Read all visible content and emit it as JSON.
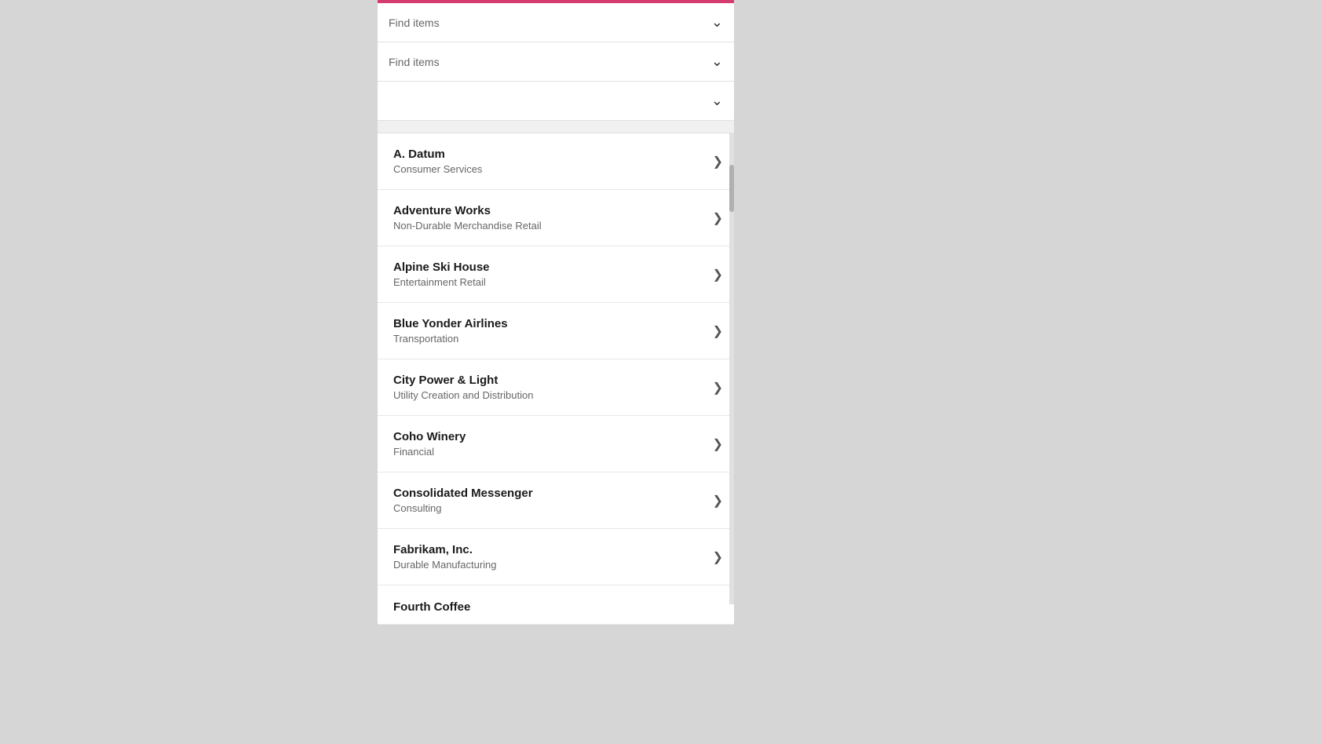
{
  "topBar": {
    "color": "#d63b6e"
  },
  "filters": [
    {
      "id": "filter1",
      "label": "Find items",
      "hasChevron": true
    },
    {
      "id": "filter2",
      "label": "Find items",
      "hasChevron": true
    },
    {
      "id": "filter3",
      "label": "",
      "hasChevron": true
    }
  ],
  "listItems": [
    {
      "id": "a-datum",
      "title": "A. Datum",
      "subtitle": "Consumer Services"
    },
    {
      "id": "adventure-works",
      "title": "Adventure Works",
      "subtitle": "Non-Durable Merchandise Retail"
    },
    {
      "id": "alpine-ski-house",
      "title": "Alpine Ski House",
      "subtitle": "Entertainment Retail"
    },
    {
      "id": "blue-yonder-airlines",
      "title": "Blue Yonder Airlines",
      "subtitle": "Transportation"
    },
    {
      "id": "city-power-light",
      "title": "City Power & Light",
      "subtitle": "Utility Creation and Distribution"
    },
    {
      "id": "coho-winery",
      "title": "Coho Winery",
      "subtitle": "Financial"
    },
    {
      "id": "consolidated-messenger",
      "title": "Consolidated Messenger",
      "subtitle": "Consulting"
    },
    {
      "id": "fabrikam-inc",
      "title": "Fabrikam, Inc.",
      "subtitle": "Durable Manufacturing"
    }
  ],
  "partialItem": {
    "title": "Fourth Coffee"
  },
  "icons": {
    "chevronDown": "⌄",
    "chevronRight": "❯"
  }
}
